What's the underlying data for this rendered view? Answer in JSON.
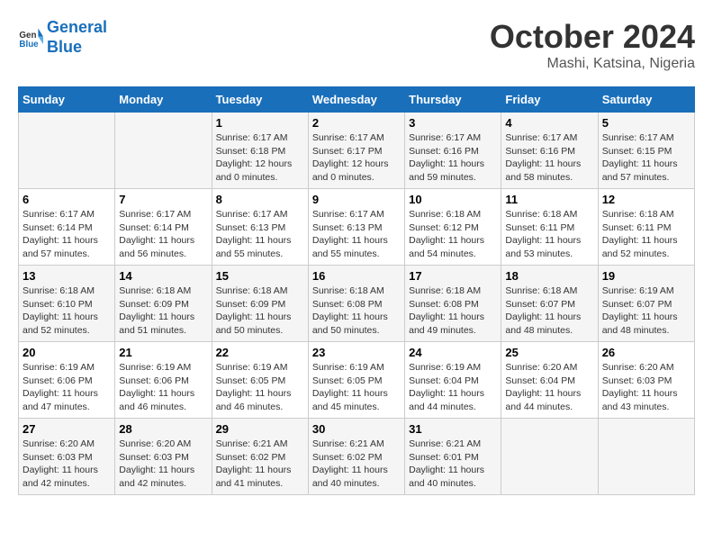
{
  "header": {
    "logo_line1": "General",
    "logo_line2": "Blue",
    "month": "October 2024",
    "location": "Mashi, Katsina, Nigeria"
  },
  "days_of_week": [
    "Sunday",
    "Monday",
    "Tuesday",
    "Wednesday",
    "Thursday",
    "Friday",
    "Saturday"
  ],
  "weeks": [
    [
      {
        "day": "",
        "info": ""
      },
      {
        "day": "",
        "info": ""
      },
      {
        "day": "1",
        "info": "Sunrise: 6:17 AM\nSunset: 6:18 PM\nDaylight: 12 hours\nand 0 minutes."
      },
      {
        "day": "2",
        "info": "Sunrise: 6:17 AM\nSunset: 6:17 PM\nDaylight: 12 hours\nand 0 minutes."
      },
      {
        "day": "3",
        "info": "Sunrise: 6:17 AM\nSunset: 6:16 PM\nDaylight: 11 hours\nand 59 minutes."
      },
      {
        "day": "4",
        "info": "Sunrise: 6:17 AM\nSunset: 6:16 PM\nDaylight: 11 hours\nand 58 minutes."
      },
      {
        "day": "5",
        "info": "Sunrise: 6:17 AM\nSunset: 6:15 PM\nDaylight: 11 hours\nand 57 minutes."
      }
    ],
    [
      {
        "day": "6",
        "info": "Sunrise: 6:17 AM\nSunset: 6:14 PM\nDaylight: 11 hours\nand 57 minutes."
      },
      {
        "day": "7",
        "info": "Sunrise: 6:17 AM\nSunset: 6:14 PM\nDaylight: 11 hours\nand 56 minutes."
      },
      {
        "day": "8",
        "info": "Sunrise: 6:17 AM\nSunset: 6:13 PM\nDaylight: 11 hours\nand 55 minutes."
      },
      {
        "day": "9",
        "info": "Sunrise: 6:17 AM\nSunset: 6:13 PM\nDaylight: 11 hours\nand 55 minutes."
      },
      {
        "day": "10",
        "info": "Sunrise: 6:18 AM\nSunset: 6:12 PM\nDaylight: 11 hours\nand 54 minutes."
      },
      {
        "day": "11",
        "info": "Sunrise: 6:18 AM\nSunset: 6:11 PM\nDaylight: 11 hours\nand 53 minutes."
      },
      {
        "day": "12",
        "info": "Sunrise: 6:18 AM\nSunset: 6:11 PM\nDaylight: 11 hours\nand 52 minutes."
      }
    ],
    [
      {
        "day": "13",
        "info": "Sunrise: 6:18 AM\nSunset: 6:10 PM\nDaylight: 11 hours\nand 52 minutes."
      },
      {
        "day": "14",
        "info": "Sunrise: 6:18 AM\nSunset: 6:09 PM\nDaylight: 11 hours\nand 51 minutes."
      },
      {
        "day": "15",
        "info": "Sunrise: 6:18 AM\nSunset: 6:09 PM\nDaylight: 11 hours\nand 50 minutes."
      },
      {
        "day": "16",
        "info": "Sunrise: 6:18 AM\nSunset: 6:08 PM\nDaylight: 11 hours\nand 50 minutes."
      },
      {
        "day": "17",
        "info": "Sunrise: 6:18 AM\nSunset: 6:08 PM\nDaylight: 11 hours\nand 49 minutes."
      },
      {
        "day": "18",
        "info": "Sunrise: 6:18 AM\nSunset: 6:07 PM\nDaylight: 11 hours\nand 48 minutes."
      },
      {
        "day": "19",
        "info": "Sunrise: 6:19 AM\nSunset: 6:07 PM\nDaylight: 11 hours\nand 48 minutes."
      }
    ],
    [
      {
        "day": "20",
        "info": "Sunrise: 6:19 AM\nSunset: 6:06 PM\nDaylight: 11 hours\nand 47 minutes."
      },
      {
        "day": "21",
        "info": "Sunrise: 6:19 AM\nSunset: 6:06 PM\nDaylight: 11 hours\nand 46 minutes."
      },
      {
        "day": "22",
        "info": "Sunrise: 6:19 AM\nSunset: 6:05 PM\nDaylight: 11 hours\nand 46 minutes."
      },
      {
        "day": "23",
        "info": "Sunrise: 6:19 AM\nSunset: 6:05 PM\nDaylight: 11 hours\nand 45 minutes."
      },
      {
        "day": "24",
        "info": "Sunrise: 6:19 AM\nSunset: 6:04 PM\nDaylight: 11 hours\nand 44 minutes."
      },
      {
        "day": "25",
        "info": "Sunrise: 6:20 AM\nSunset: 6:04 PM\nDaylight: 11 hours\nand 44 minutes."
      },
      {
        "day": "26",
        "info": "Sunrise: 6:20 AM\nSunset: 6:03 PM\nDaylight: 11 hours\nand 43 minutes."
      }
    ],
    [
      {
        "day": "27",
        "info": "Sunrise: 6:20 AM\nSunset: 6:03 PM\nDaylight: 11 hours\nand 42 minutes."
      },
      {
        "day": "28",
        "info": "Sunrise: 6:20 AM\nSunset: 6:03 PM\nDaylight: 11 hours\nand 42 minutes."
      },
      {
        "day": "29",
        "info": "Sunrise: 6:21 AM\nSunset: 6:02 PM\nDaylight: 11 hours\nand 41 minutes."
      },
      {
        "day": "30",
        "info": "Sunrise: 6:21 AM\nSunset: 6:02 PM\nDaylight: 11 hours\nand 40 minutes."
      },
      {
        "day": "31",
        "info": "Sunrise: 6:21 AM\nSunset: 6:01 PM\nDaylight: 11 hours\nand 40 minutes."
      },
      {
        "day": "",
        "info": ""
      },
      {
        "day": "",
        "info": ""
      }
    ]
  ]
}
